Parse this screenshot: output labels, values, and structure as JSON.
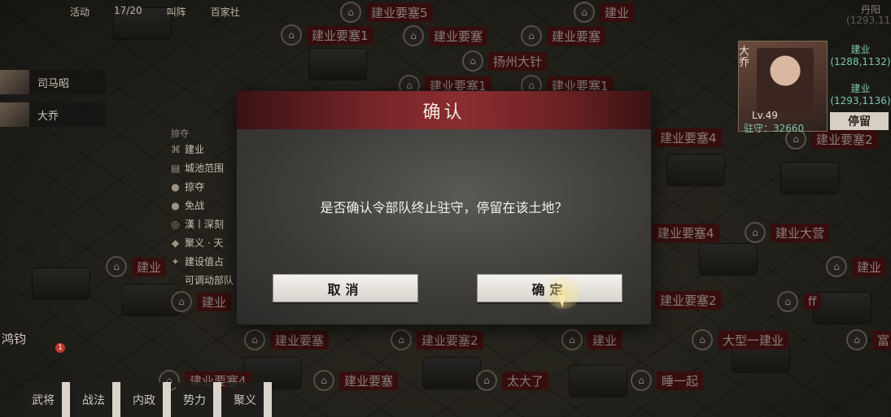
{
  "topbar": {
    "items": [
      "活动",
      "17/20",
      "叫阵",
      "百家社"
    ]
  },
  "map_labels": [
    "建业要塞5",
    "建业要塞1",
    "建业要塞",
    "建业要塞",
    "扬州大针",
    "建业要塞1",
    "建业要塞1",
    "建业要塞4",
    "建业要塞2",
    "建业要塞4",
    "建业大营",
    "建业",
    "建业要塞",
    "建业要塞2",
    "建业",
    "大型一建业",
    "富",
    "建业要塞4",
    "建业要塞",
    "太大了",
    "睡一起",
    "建业要塞2",
    "ff",
    "建业",
    "建业",
    "丹阳",
    "(1293,113"
  ],
  "left": {
    "characters": [
      {
        "name": "司马昭"
      },
      {
        "name": "大乔"
      }
    ],
    "panel_tag": "掠夺",
    "panel": [
      "建业",
      "城池范围",
      "掠夺",
      "免战",
      "漢丨深刻",
      "聚义 · 天",
      "建设值占",
      "可调动部队"
    ]
  },
  "right": {
    "hero_name": "大乔",
    "level": "Lv.49",
    "garrison": "驻守：32660",
    "loc1": {
      "name": "建业",
      "coord": "(1288,1132)"
    },
    "loc2": {
      "name": "建业",
      "coord": "(1293,1136)"
    },
    "stay_label": "停留"
  },
  "bottom": {
    "name": "鸿钧",
    "badge": "1",
    "tabs": [
      "武将",
      "战法",
      "内政",
      "势力",
      "聚义"
    ]
  },
  "modal": {
    "title": "确认",
    "message": "是否确认令部队终止驻守，停留在该土地？",
    "cancel": "取消",
    "confirm": "确定"
  },
  "colors": {
    "modal_header": "#7a2629",
    "button_bg": "#f4f2ee",
    "label_bg": "#5f1214"
  }
}
